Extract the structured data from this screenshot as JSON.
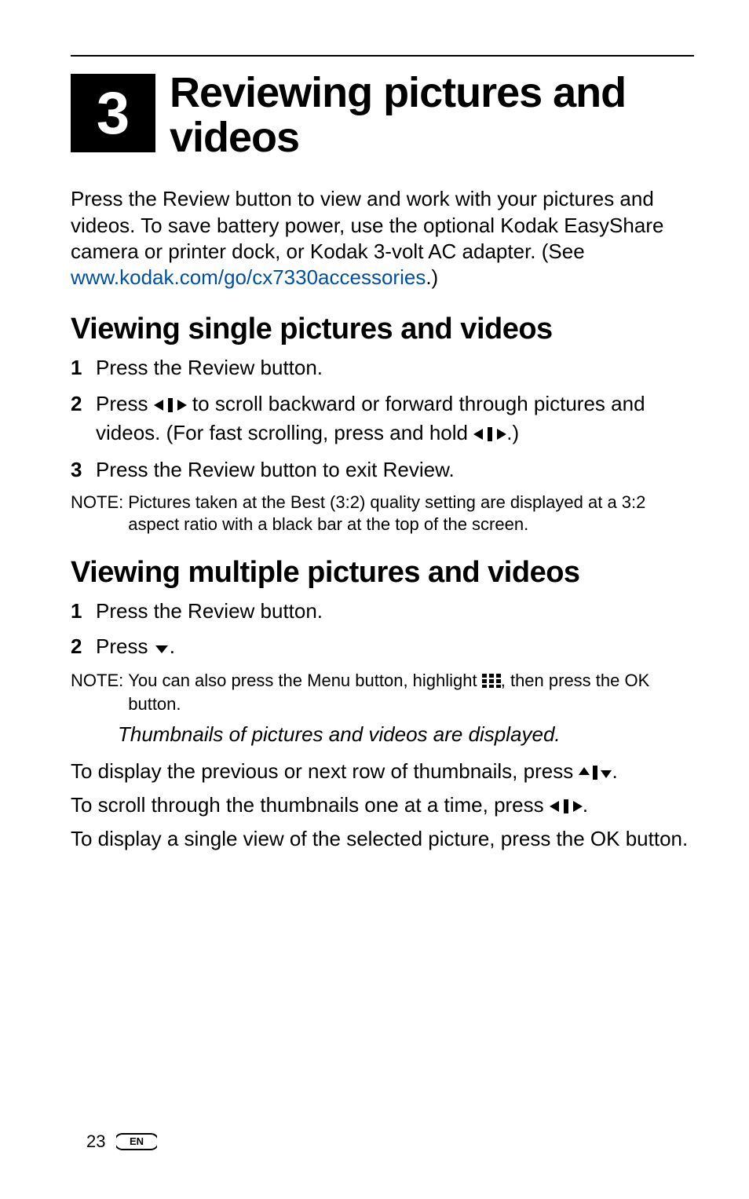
{
  "chapter": {
    "number": "3",
    "title": "Reviewing pictures and videos"
  },
  "intro": {
    "part1": "Press the Review button to view and work with your pictures and videos. To save battery power, use the optional Kodak EasyShare camera or printer dock, or Kodak 3-volt AC adapter. (See ",
    "link_text": "www.kodak.com/go/cx7330accessories",
    "part2": ".)"
  },
  "section1": {
    "heading": "Viewing single pictures and videos",
    "step1": "Press the Review button.",
    "step2_a": "Press ",
    "step2_b": " to scroll backward or forward through pictures and videos. (For fast scrolling, press and hold ",
    "step2_c": ".)",
    "step3": "Press the Review button to exit Review.",
    "note_label": "NOTE:",
    "note_body": "Pictures taken at the Best (3:2) quality setting are displayed at a 3:2 aspect ratio with a black bar at the top of the screen."
  },
  "section2": {
    "heading": "Viewing multiple pictures and videos",
    "step1": "Press the Review button.",
    "step2_a": "Press ",
    "step2_b": ".",
    "note_label": "NOTE:",
    "note_a": "You can also press the Menu button, highlight ",
    "note_b": ", then press the OK button.",
    "emph": "Thumbnails of pictures and videos are displayed.",
    "p1_a": "To display the previous or next row of thumbnails, press ",
    "p1_b": ".",
    "p2_a": "To scroll through the thumbnails one at a time, press ",
    "p2_b": ".",
    "p3": "To display a single view of the selected picture, press the OK button."
  },
  "footer": {
    "page": "23",
    "lang": "EN"
  }
}
